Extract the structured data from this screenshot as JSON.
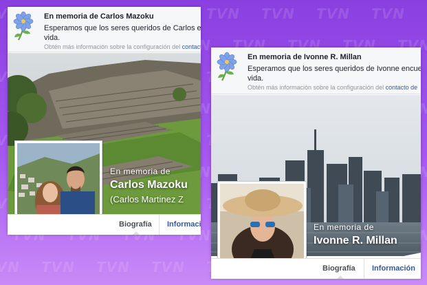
{
  "background": {
    "watermark_text": "TVN",
    "gradient_top": "#8a3fe0",
    "gradient_bottom": "#c98bf7"
  },
  "cards": [
    {
      "notice": {
        "title": "En memoria de Carlos Mazoku",
        "body_line1": "Esperamos que los seres queridos de Carlos encu",
        "body_line2": "vida.",
        "more_text": "Obtén más información sobre la configuración del",
        "more_link": "contacto"
      },
      "memorial": {
        "label": "En memoria de",
        "name": "Carlos Mazoku",
        "alt_name": "(Carlos Martinez Z"
      },
      "tabs": {
        "bio": "Biografía",
        "info": "Informació"
      }
    },
    {
      "notice": {
        "title": "En memoria de Ivonne R. Millan",
        "body_line1": "Esperamos que los seres queridos de Ivonne encuen",
        "body_line2": "vida.",
        "more_text": "Obtén más información sobre la configuración del",
        "more_link": "contacto de"
      },
      "memorial": {
        "label": "En memoria de",
        "name": "Ivonne R. Millan"
      },
      "tabs": {
        "bio": "Biografía",
        "info": "Información"
      }
    }
  ],
  "colors": {
    "link": "#365899",
    "notice_bg": "#f6f7f9",
    "text": "#1d2129",
    "muted": "#90949c"
  },
  "icons": {
    "memorial": "flower-icon"
  }
}
